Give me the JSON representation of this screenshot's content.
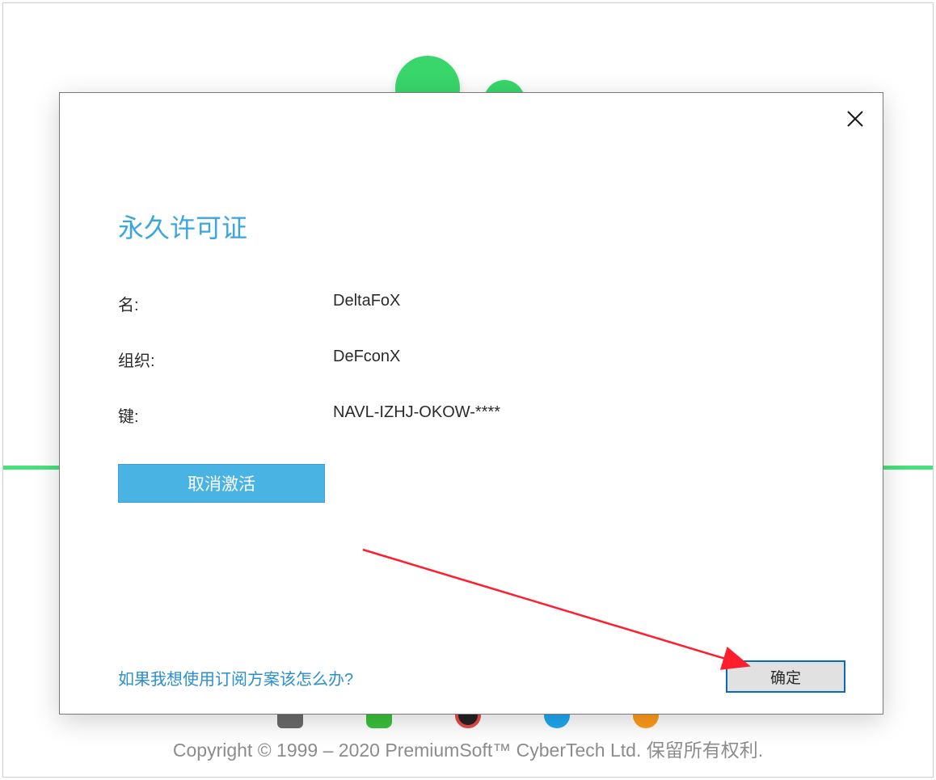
{
  "footer": {
    "copyright": "Copyright © 1999 – 2020 PremiumSoft™ CyberTech Ltd. 保留所有权利."
  },
  "dialog": {
    "title": "永久许可证",
    "fields": {
      "name_label": "名:",
      "name_value": "DeltaFoX",
      "org_label": "组织:",
      "org_value": "DeFconX",
      "key_label": "键:",
      "key_value": "NAVL-IZHJ-OKOW-****"
    },
    "deactivate_label": "取消激活",
    "subscription_link": "如果我想使用订阅方案该怎么办?",
    "ok_label": "确定"
  }
}
